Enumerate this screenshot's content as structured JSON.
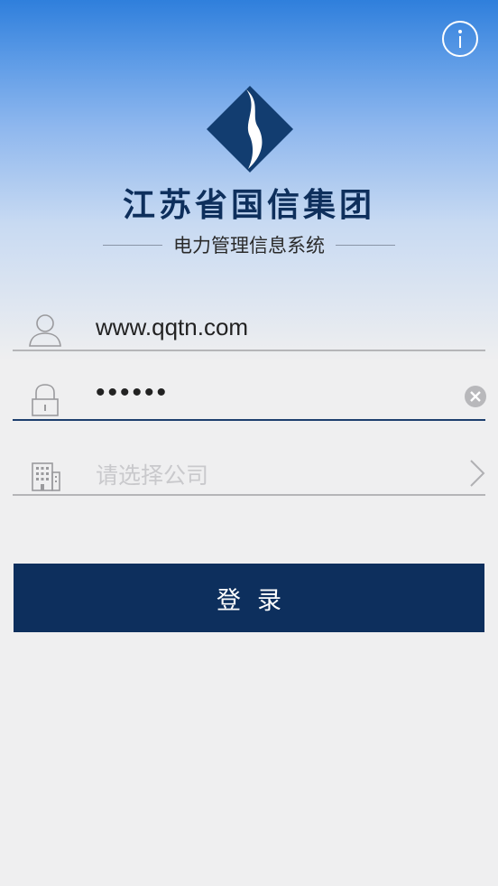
{
  "brand": {
    "company_name": "江苏省国信集团",
    "system_name": "电力管理信息系统"
  },
  "info_button": {
    "icon": "info-icon",
    "glyph": "i"
  },
  "form": {
    "username": {
      "icon": "user-icon",
      "value": "www.qqtn.com"
    },
    "password": {
      "icon": "lock-icon",
      "masked_value": "••••••",
      "clear_icon": "clear-icon"
    },
    "company": {
      "icon": "building-icon",
      "placeholder": "请选择公司",
      "chevron_icon": "chevron-right-icon"
    }
  },
  "login_button": {
    "label": "登录"
  },
  "colors": {
    "brand_navy": "#0d2f5d",
    "gradient_top": "#2f7fdc",
    "background": "#efeff0",
    "active_underline": "#1d3f6e"
  }
}
